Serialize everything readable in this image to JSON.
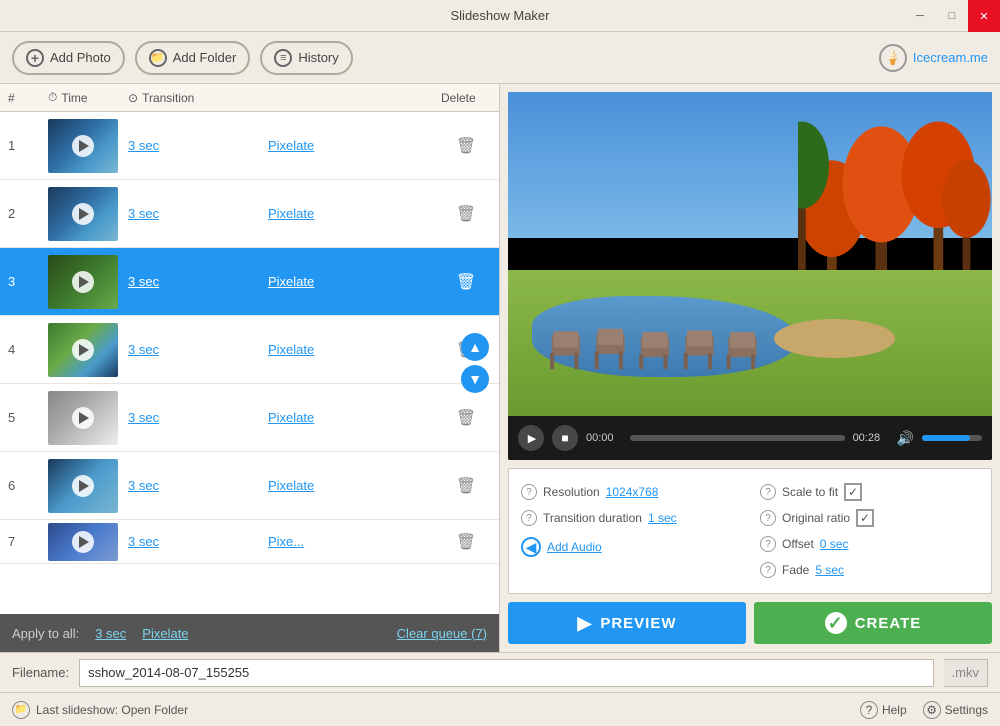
{
  "app": {
    "title": "Slideshow Maker",
    "version": ""
  },
  "titlebar": {
    "minimize_label": "─",
    "maximize_label": "□",
    "close_label": "✕"
  },
  "toolbar": {
    "add_photo_label": "Add Photo",
    "add_folder_label": "Add Folder",
    "history_label": "History",
    "brand_label": "Icecream.me"
  },
  "table": {
    "col_hash": "#",
    "col_time": "Time",
    "col_transition": "Transition",
    "col_delete": "Delete"
  },
  "rows": [
    {
      "num": "1",
      "time": "3 sec",
      "transition": "Pixelate",
      "selected": false,
      "thumb": "thumb-1"
    },
    {
      "num": "2",
      "time": "3 sec",
      "transition": "Pixelate",
      "selected": false,
      "thumb": "thumb-2"
    },
    {
      "num": "3",
      "time": "3 sec",
      "transition": "Pixelate",
      "selected": true,
      "thumb": "thumb-3"
    },
    {
      "num": "4",
      "time": "3 sec",
      "transition": "Pixelate",
      "selected": false,
      "thumb": "thumb-4"
    },
    {
      "num": "5",
      "time": "3 sec",
      "transition": "Pixelate",
      "selected": false,
      "thumb": "thumb-5"
    },
    {
      "num": "6",
      "time": "3 sec",
      "transition": "Pixelate",
      "selected": false,
      "thumb": "thumb-6"
    },
    {
      "num": "7",
      "time": "3 sec",
      "transition": "Pixe...",
      "selected": false,
      "thumb": "thumb-7"
    }
  ],
  "apply_bar": {
    "label": "Apply to all:",
    "time": "3 sec",
    "transition": "Pixelate",
    "clear": "Clear queue (7)"
  },
  "video": {
    "time_current": "00:00",
    "time_total": "00:28"
  },
  "settings": {
    "resolution_label": "Resolution",
    "resolution_value": "1024x768",
    "transition_duration_label": "Transition duration",
    "transition_duration_value": "1 sec",
    "scale_to_fit_label": "Scale to fit",
    "original_ratio_label": "Original ratio",
    "offset_label": "Offset",
    "offset_value": "0 sec",
    "fade_label": "Fade",
    "fade_value": "5 sec",
    "add_audio_label": "Add Audio"
  },
  "actions": {
    "preview_label": "PREVIEW",
    "create_label": "CREATE"
  },
  "filename_bar": {
    "label": "Filename:",
    "value": "sshow_2014-08-07_155255",
    "extension": ".mkv"
  },
  "status": {
    "text": "Last slideshow: Open Folder",
    "help_label": "Help",
    "settings_label": "Settings"
  }
}
